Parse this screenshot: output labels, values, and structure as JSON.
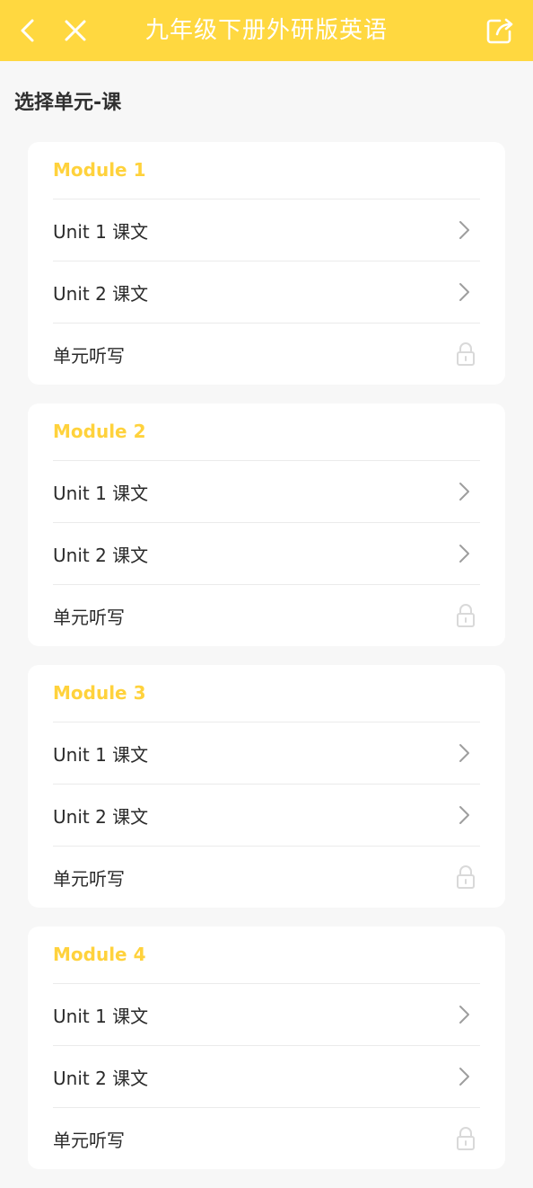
{
  "header": {
    "title": "九年级下册外研版英语",
    "back_icon": "back-arrow-icon",
    "close_icon": "close-icon",
    "share_icon": "share-icon",
    "bg_color": "#ffd840"
  },
  "section_title": "选择单元-课",
  "modules": [
    {
      "title": "Module 1",
      "items": [
        {
          "label": "Unit 1 课文",
          "icon": "chevron-right-icon"
        },
        {
          "label": "Unit 2 课文",
          "icon": "chevron-right-icon"
        },
        {
          "label": "单元听写",
          "icon": "lock-icon"
        }
      ]
    },
    {
      "title": "Module 2",
      "items": [
        {
          "label": "Unit 1 课文",
          "icon": "chevron-right-icon"
        },
        {
          "label": "Unit 2 课文",
          "icon": "chevron-right-icon"
        },
        {
          "label": "单元听写",
          "icon": "lock-icon"
        }
      ]
    },
    {
      "title": "Module 3",
      "items": [
        {
          "label": "Unit 1 课文",
          "icon": "chevron-right-icon"
        },
        {
          "label": "Unit 2 课文",
          "icon": "chevron-right-icon"
        },
        {
          "label": "单元听写",
          "icon": "lock-icon"
        }
      ]
    },
    {
      "title": "Module 4",
      "items": [
        {
          "label": "Unit 1 课文",
          "icon": "chevron-right-icon"
        },
        {
          "label": "Unit 2 课文",
          "icon": "chevron-right-icon"
        },
        {
          "label": "单元听写",
          "icon": "lock-icon"
        }
      ]
    }
  ],
  "colors": {
    "accent": "#ffd23c",
    "background": "#f7f7f7"
  }
}
